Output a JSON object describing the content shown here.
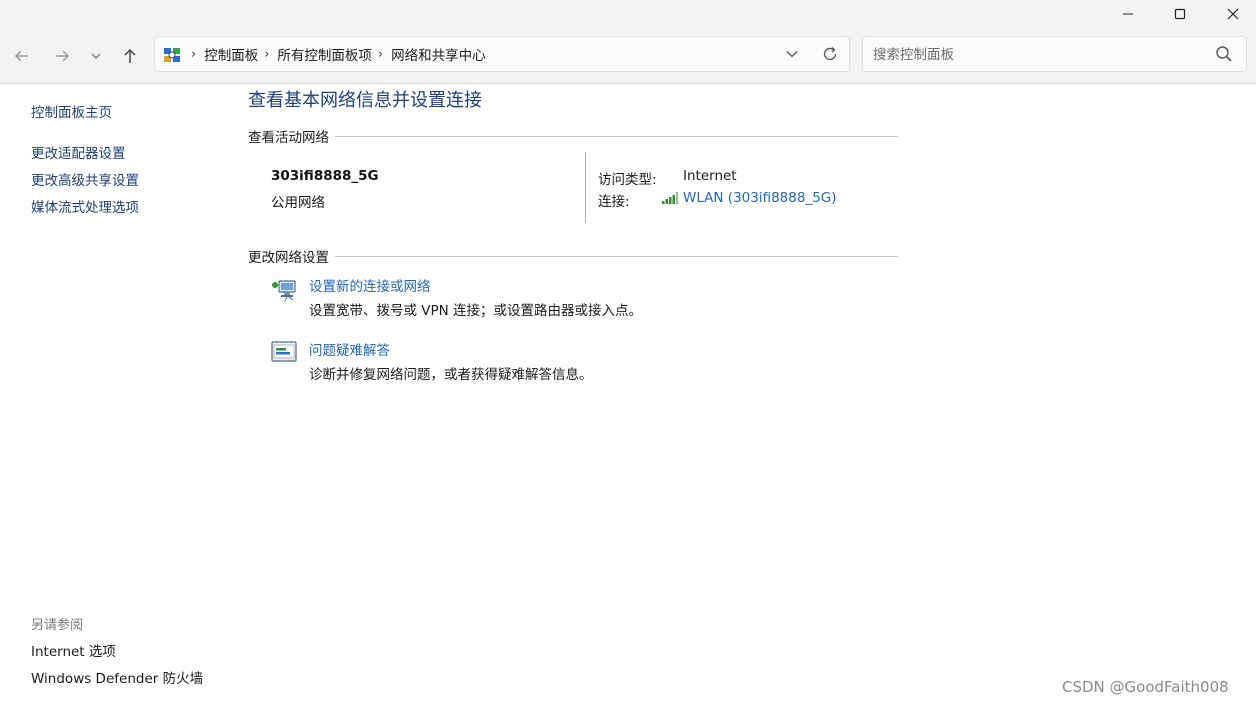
{
  "window": {
    "controls": [
      "minimize-icon",
      "maximize-icon",
      "close-icon"
    ]
  },
  "address_bar": {
    "breadcrumbs": [
      "控制面板",
      "所有控制面板项",
      "网络和共享中心"
    ]
  },
  "search": {
    "placeholder": "搜索控制面板"
  },
  "sidebar": {
    "home": "控制面板主页",
    "links": [
      "更改适配器设置",
      "更改高级共享设置",
      "媒体流式处理选项"
    ],
    "see_also_title": "另请参阅",
    "see_also": [
      "Internet 选项",
      "Windows Defender 防火墙"
    ]
  },
  "main": {
    "title": "查看基本网络信息并设置连接",
    "active_section": "查看活动网络",
    "network": {
      "name": "303ifi8888_5G",
      "category": "公用网络",
      "access_label": "访问类型:",
      "access_value": "Internet",
      "connection_label": "连接:",
      "connection_value": "WLAN (303ifi8888_5G)"
    },
    "change_section": "更改网络设置",
    "tasks": [
      {
        "label": "设置新的连接或网络",
        "desc": "设置宽带、拨号或 VPN 连接；或设置路由器或接入点。",
        "icon": "new-connection-icon"
      },
      {
        "label": "问题疑难解答",
        "desc": "诊断并修复网络问题，或者获得疑难解答信息。",
        "icon": "troubleshoot-icon"
      }
    ]
  },
  "colors": {
    "link": "#2566b8",
    "title": "#1e3f7a",
    "sidebar_link": "#1f3f74"
  },
  "watermark": "CSDN @GoodFaith008"
}
